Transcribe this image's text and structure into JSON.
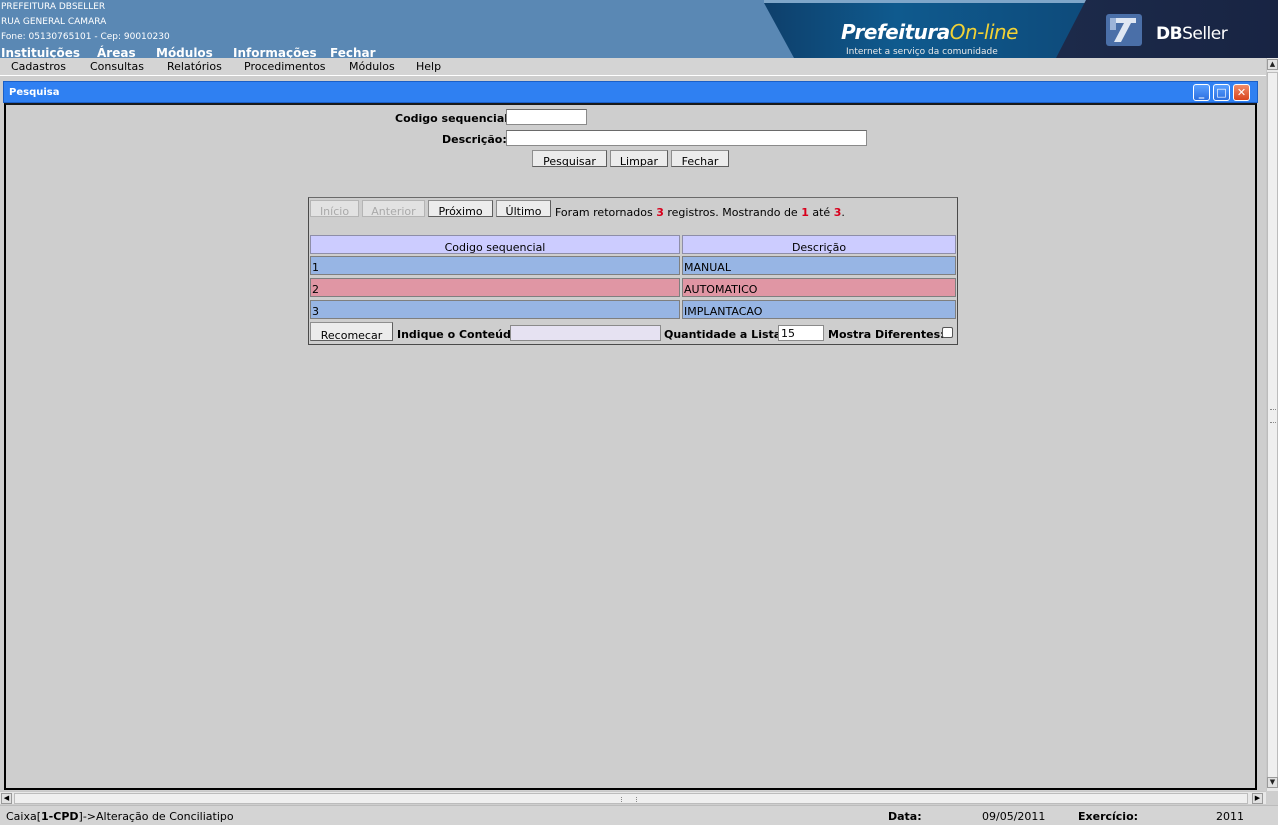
{
  "header": {
    "org_name": "PREFEITURA DBSELLER",
    "address": "RUA GENERAL CAMARA",
    "contact": "Fone: 05130765101  - Cep: 90010230",
    "nav": [
      "Instituições",
      "Áreas",
      "Módulos",
      "Informações",
      "Fechar"
    ],
    "banner_brand": "Prefeitura",
    "banner_brand_accent": "On-line",
    "banner_tagline": "Internet a serviço da comunidade",
    "logo_bold": "DB",
    "logo_text": "Seller"
  },
  "menubar": [
    "Cadastros",
    "Consultas",
    "Relatórios",
    "Procedimentos",
    "Módulos",
    "Help"
  ],
  "window": {
    "title": "Pesquisa",
    "controls": {
      "minimize": "_",
      "maximize": "□",
      "close": "✕"
    }
  },
  "form": {
    "codigo_label": "Codigo sequencial:",
    "codigo_value": "",
    "descricao_label": "Descrição:",
    "descricao_value": "",
    "buttons": {
      "pesquisar": "Pesquisar",
      "limpar": "Limpar",
      "fechar": "Fechar"
    }
  },
  "results": {
    "pager": {
      "inicio": "Início",
      "anterior": "Anterior",
      "proximo": "Próximo",
      "ultimo": "Último"
    },
    "info_prefix": "Foram retornados",
    "info_total": "3",
    "info_mid": "registros. Mostrando de",
    "info_from": "1",
    "info_ate": "até",
    "info_to": "3",
    "info_end": ".",
    "columns": [
      "Codigo sequencial",
      "Descrição"
    ],
    "rows": [
      {
        "codigo": "1",
        "descricao": "MANUAL"
      },
      {
        "codigo": "2",
        "descricao": "AUTOMATICO"
      },
      {
        "codigo": "3",
        "descricao": "IMPLANTACAO"
      }
    ],
    "footer": {
      "recomecar": "Recomecar",
      "indique_label": "Indique o Conteúdo:",
      "indique_value": "",
      "quantidade_label": "Quantidade a Listar:",
      "quantidade_value": "15",
      "mostra_label": "Mostra Diferentes:",
      "mostra_checked": false
    }
  },
  "status": {
    "module_prefix": "Caixa[",
    "module_code": "1-CPD",
    "module_suffix": "]->Alteração de Conciliatipo",
    "data_label": "Data:",
    "data_value": "09/05/2011",
    "exercicio_label": "Exercício:",
    "exercicio_value": "2011"
  },
  "colors": {
    "header_bg": "#5a88b4",
    "titlebar": "#2f80f2",
    "table_header": "#ccccff",
    "row_blue": "#97b5e4",
    "row_pink": "#e096a4",
    "info_red": "#d8001c"
  }
}
